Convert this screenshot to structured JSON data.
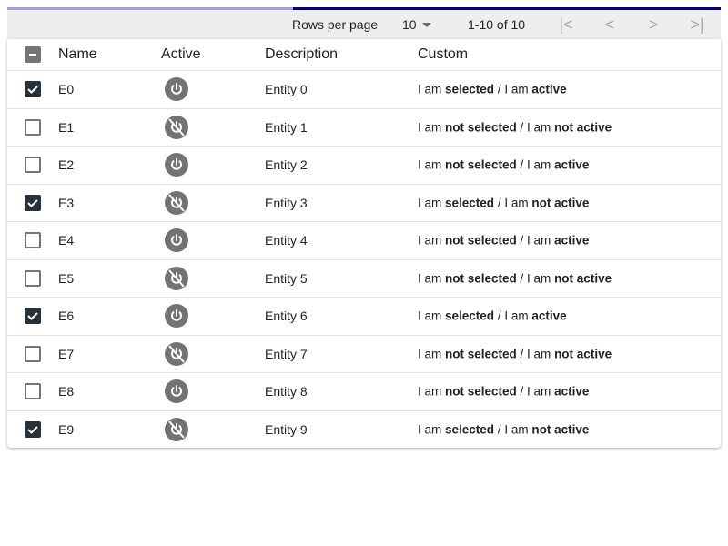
{
  "progress": {
    "value_percent": 40,
    "colors": {
      "track": "#9f9fd4",
      "fill": "#000080"
    }
  },
  "pagination": {
    "rows_per_page_label": "Rows per page",
    "rows_per_page": "10",
    "range": "1-10 of 10",
    "first_icon": "first-page-icon",
    "prev_icon": "chevron-left-icon",
    "next_icon": "chevron-right-icon",
    "last_icon": "last-page-icon"
  },
  "columns": {
    "name": "Name",
    "active": "Active",
    "description": "Description",
    "custom": "Custom"
  },
  "custom_text": {
    "i_am": "I am ",
    "selected": "selected",
    "not_selected": "not selected",
    "sep": " / I am ",
    "active": "active",
    "not_active": "not active"
  },
  "rows": [
    {
      "name": "E0",
      "description": "Entity 0",
      "selected": true,
      "active": true
    },
    {
      "name": "E1",
      "description": "Entity 1",
      "selected": false,
      "active": false
    },
    {
      "name": "E2",
      "description": "Entity 2",
      "selected": false,
      "active": true
    },
    {
      "name": "E3",
      "description": "Entity 3",
      "selected": true,
      "active": false
    },
    {
      "name": "E4",
      "description": "Entity 4",
      "selected": false,
      "active": true
    },
    {
      "name": "E5",
      "description": "Entity 5",
      "selected": false,
      "active": false
    },
    {
      "name": "E6",
      "description": "Entity 6",
      "selected": true,
      "active": true
    },
    {
      "name": "E7",
      "description": "Entity 7",
      "selected": false,
      "active": false
    },
    {
      "name": "E8",
      "description": "Entity 8",
      "selected": false,
      "active": true
    },
    {
      "name": "E9",
      "description": "Entity 9",
      "selected": true,
      "active": false
    }
  ]
}
